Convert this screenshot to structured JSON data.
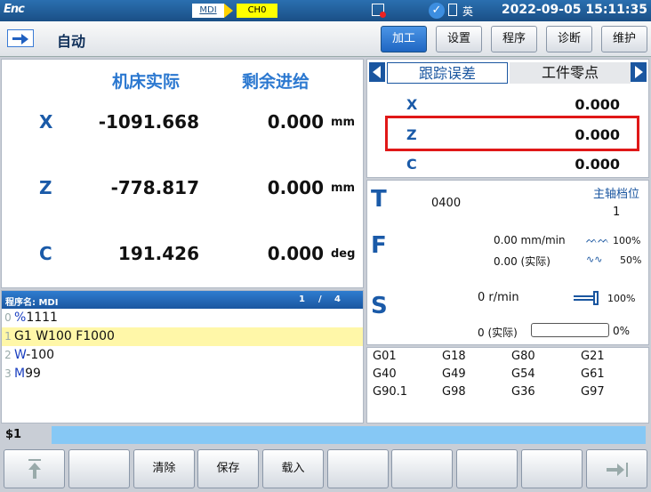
{
  "statusbar": {
    "logo": "Enc",
    "mode": "MDI",
    "channel": "CH0",
    "lang": "英",
    "datetime": "2022-09-05 15:11:35"
  },
  "modebar": {
    "mode_label": "自动",
    "tabs": [
      "加工",
      "设置",
      "程序",
      "诊断",
      "维护"
    ],
    "active_tab": "加工"
  },
  "axes": {
    "col_machine": "机床实际",
    "col_remaining": "剩余进给",
    "rows": [
      {
        "name": "X",
        "machine": "-1091.668",
        "remaining": "0.000",
        "unit": "mm"
      },
      {
        "name": "Z",
        "machine": "-778.817",
        "remaining": "0.000",
        "unit": "mm"
      },
      {
        "name": "C",
        "machine": "191.426",
        "remaining": "0.000",
        "unit": "deg"
      }
    ]
  },
  "program": {
    "name_label": "程序名: MDI",
    "page_current": "1",
    "page_sep": "/",
    "page_total": "4",
    "lines": [
      {
        "num": "0",
        "kw": "%",
        "rest": "1111"
      },
      {
        "num": "1",
        "kw": "",
        "rest": "G1 W100 F1000"
      },
      {
        "num": "2",
        "kw": "W",
        "rest": "-100"
      },
      {
        "num": "3",
        "kw": "M",
        "rest": "99"
      }
    ]
  },
  "offsets": {
    "tab_active": "跟踪误差",
    "tab_other": "工件零点",
    "rows": [
      {
        "name": "X",
        "value": "0.000"
      },
      {
        "name": "Z",
        "value": "0.000"
      },
      {
        "name": "C",
        "value": "0.000"
      }
    ]
  },
  "status": {
    "T_label": "T",
    "tool": "0400",
    "gear_label": "主轴档位",
    "gear_value": "1",
    "F_label": "F",
    "feed_set": "0.00 mm/min",
    "feed_override": "100%",
    "feed_actual": "0.00 (实际)",
    "rapid_override": "50%",
    "S_label": "S",
    "speed_set": "0 r/min",
    "spindle_override": "100%",
    "speed_actual": "0 (实际)",
    "load_pct": "0%"
  },
  "gcodes": [
    "G01",
    "G18",
    "G80",
    "G21",
    "G40",
    "G49",
    "G54",
    "G61",
    "G90.1",
    "G98",
    "G36",
    "G97"
  ],
  "cmdline": {
    "label": "$1"
  },
  "softkeys": {
    "k3": "清除",
    "k4": "保存",
    "k5": "载入"
  }
}
